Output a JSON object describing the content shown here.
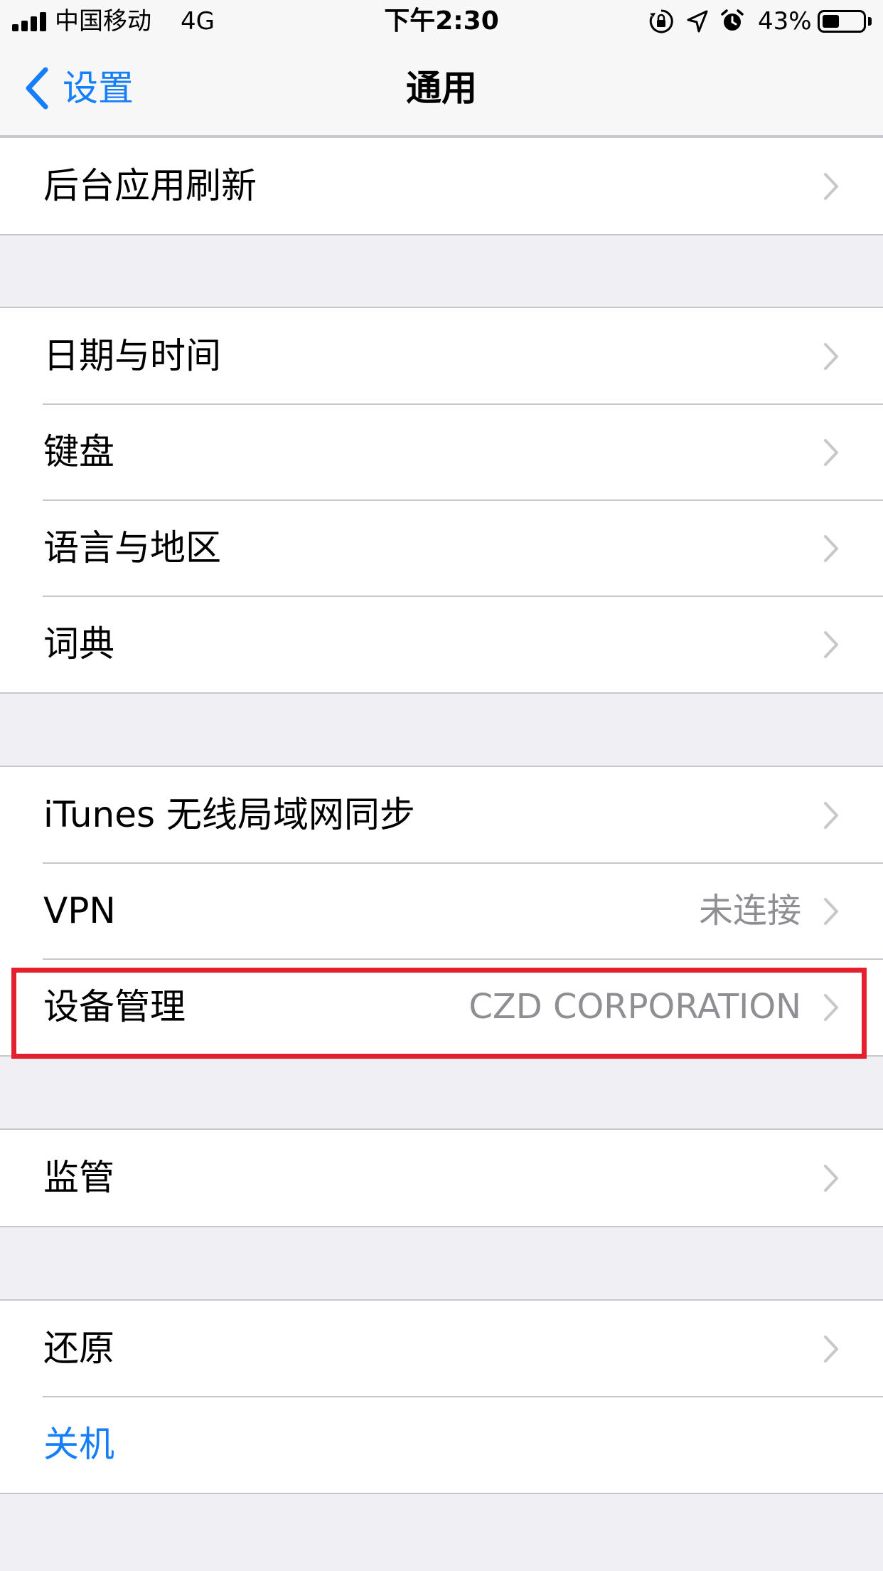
{
  "status_bar": {
    "carrier": "中国移动",
    "network": "4G",
    "time": "下午2:30",
    "battery_percent": "43%",
    "battery_level": 0.43,
    "icons": [
      "orientation-lock-icon",
      "location-arrow-icon",
      "alarm-icon",
      "battery-icon"
    ]
  },
  "nav": {
    "back_label": "设置",
    "title": "通用"
  },
  "sections": [
    {
      "rows": [
        {
          "label": "后台应用刷新",
          "value": ""
        }
      ]
    },
    {
      "rows": [
        {
          "label": "日期与时间",
          "value": ""
        },
        {
          "label": "键盘",
          "value": ""
        },
        {
          "label": "语言与地区",
          "value": ""
        },
        {
          "label": "词典",
          "value": ""
        }
      ]
    },
    {
      "rows": [
        {
          "label": "iTunes 无线局域网同步",
          "value": ""
        },
        {
          "label": "VPN",
          "value": "未连接"
        },
        {
          "label": "设备管理",
          "value": "CZD CORPORATION"
        }
      ]
    },
    {
      "rows": [
        {
          "label": "监管",
          "value": ""
        }
      ]
    },
    {
      "rows": [
        {
          "label": "还原",
          "value": ""
        },
        {
          "label": "关机",
          "value": ""
        }
      ]
    }
  ],
  "colors": {
    "accent": "#157efb",
    "highlight": "#e5202e",
    "background": "#efeff4",
    "separator": "#c8c7cc"
  }
}
